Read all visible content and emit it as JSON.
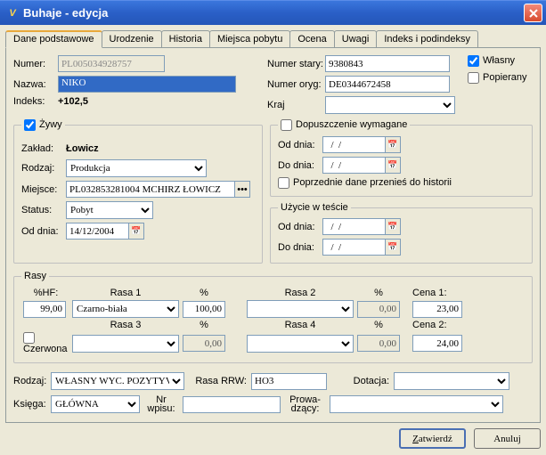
{
  "window": {
    "title": "Buhaje - edycja"
  },
  "tabs": [
    "Dane podstawowe",
    "Urodzenie",
    "Historia",
    "Miejsca pobytu",
    "Ocena",
    "Uwagi",
    "Indeks i podindeksy"
  ],
  "top": {
    "numer_lbl": "Numer:",
    "numer": "PL005034928757",
    "nazwa_lbl": "Nazwa:",
    "nazwa": "NIKO",
    "indeks_lbl": "Indeks:",
    "indeks": "+102,5",
    "numer_stary_lbl": "Numer stary:",
    "numer_stary": "9380843",
    "numer_oryg_lbl": "Numer oryg:",
    "numer_oryg": "DE0344672458",
    "kraj_lbl": "Kraj",
    "kraj": "",
    "wlasny_lbl": "Własny",
    "popierany_lbl": "Popierany"
  },
  "zywy": {
    "legend": "Żywy",
    "zaklad_lbl": "Zakład:",
    "zaklad": "Łowicz",
    "rodzaj_lbl": "Rodzaj:",
    "rodzaj": "Produkcja",
    "miejsce_lbl": "Miejsce:",
    "miejsce": "PL032853281004 MCHIRZ ŁOWICZ",
    "status_lbl": "Status:",
    "status": "Pobyt",
    "od_dnia_lbl": "Od dnia:",
    "od_dnia": "14/12/2004"
  },
  "dopusz": {
    "legend": "Dopuszczenie wymagane",
    "od_dnia_lbl": "Od dnia:",
    "od_dnia": "  /  /",
    "do_dnia_lbl": "Do dnia:",
    "do_dnia": "  /  /",
    "poprzednie_lbl": "Poprzednie dane przenieś do historii"
  },
  "uzycie": {
    "legend": "Użycie w teście",
    "od_dnia_lbl": "Od dnia:",
    "od_dnia": "  /  /",
    "do_dnia_lbl": "Do dnia:",
    "do_dnia": "  /  /"
  },
  "rasy": {
    "legend": "Rasy",
    "hf_lbl": "%HF:",
    "hf": "99,00",
    "r1_lbl": "Rasa 1",
    "r1": "Czarno-biała",
    "p1_lbl": "%",
    "p1": "100,00",
    "r2_lbl": "Rasa 2",
    "r2": "",
    "p2_lbl": "%",
    "p2": "0,00",
    "r3_lbl": "Rasa 3",
    "r3": "",
    "p3_lbl": "%",
    "p3": "0,00",
    "r4_lbl": "Rasa 4",
    "r4": "",
    "p4_lbl": "%",
    "p4": "0,00",
    "czerwona_lbl": "Czerwona",
    "cena1_lbl": "Cena 1:",
    "cena1": "23,00",
    "cena2_lbl": "Cena 2:",
    "cena2": "24,00"
  },
  "bottom": {
    "rodzaj_lbl": "Rodzaj:",
    "rodzaj": "WŁASNY WYC. POZYTYV",
    "rasa_rrw_lbl": "Rasa RRW:",
    "rasa_rrw": "HO3",
    "dotacja_lbl": "Dotacja:",
    "dotacja": "",
    "ksiega_lbl": "Księga:",
    "ksiega": "GŁÓWNA",
    "nr_wpisu_lbl": "Nr wpisu:",
    "nr_wpisu": "",
    "prowadzacy_lbl": "Prowa-dzący:",
    "prowadzacy": ""
  },
  "buttons": {
    "ok": "Zatwierdź",
    "cancel": "Anuluj"
  }
}
